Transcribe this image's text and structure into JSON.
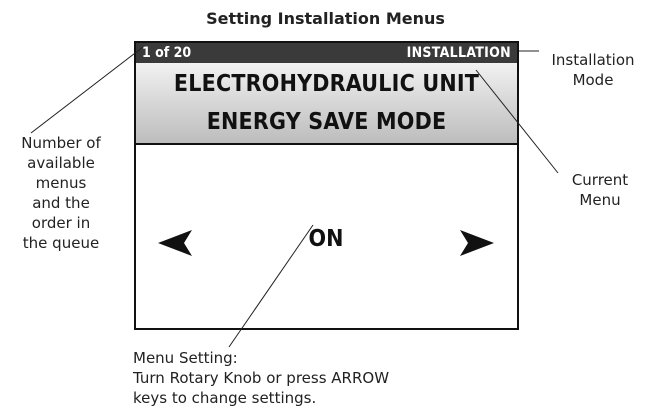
{
  "title": "Setting Installation Menus",
  "screen": {
    "page_count": "1 of 20",
    "mode": "INSTALLATION",
    "menu_line1": "ELECTROHYDRAULIC UNIT",
    "menu_line2": "ENERGY SAVE MODE",
    "value": "ON",
    "left_arrow": "arrow-left-icon",
    "right_arrow": "arrow-right-icon"
  },
  "callouts": {
    "installation_mode": [
      "Installation",
      "Mode"
    ],
    "current_menu": [
      "Current",
      "Menu"
    ],
    "number_of_menus": [
      "Number of",
      "available",
      "menus",
      "and the",
      "order in",
      "the queue"
    ],
    "menu_setting": [
      "Menu Setting:",
      "Turn Rotary Knob or press ARROW",
      "keys to change settings."
    ]
  }
}
